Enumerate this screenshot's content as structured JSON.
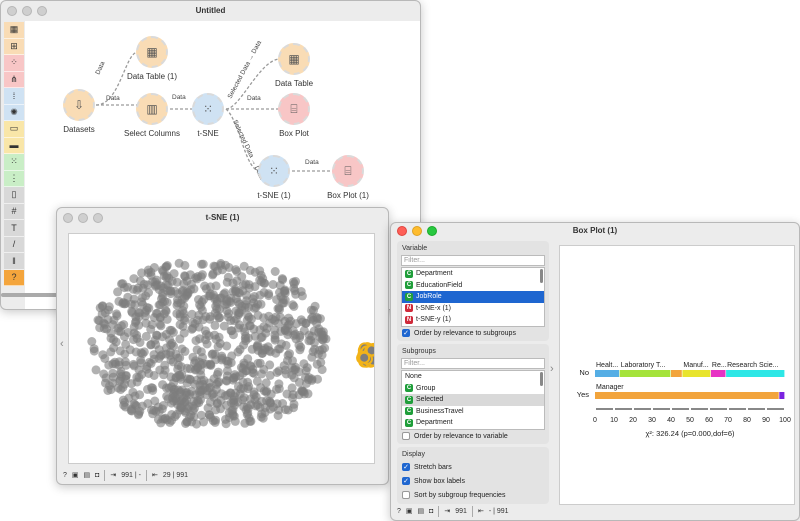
{
  "canvas_window": {
    "title": "Untitled",
    "nodes": [
      {
        "id": "datasets",
        "label": "Datasets",
        "color": "#f9dcb5",
        "icon": "dataset-icon"
      },
      {
        "id": "data_table_1",
        "label": "Data Table (1)",
        "color": "#f9dcb5",
        "icon": "table-icon"
      },
      {
        "id": "select_columns",
        "label": "Select Columns",
        "color": "#f9dcb5",
        "icon": "columns-icon"
      },
      {
        "id": "tsne",
        "label": "t-SNE",
        "color": "#cfe2f3",
        "icon": "tsne-icon"
      },
      {
        "id": "data_table",
        "label": "Data Table",
        "color": "#f9dcb5",
        "icon": "table-icon"
      },
      {
        "id": "box_plot",
        "label": "Box Plot",
        "color": "#f8c6c6",
        "icon": "boxplot-icon"
      },
      {
        "id": "tsne_1",
        "label": "t-SNE (1)",
        "color": "#cfe2f3",
        "icon": "tsne-icon"
      },
      {
        "id": "box_plot_1",
        "label": "Box Plot (1)",
        "color": "#f8c6c6",
        "icon": "boxplot-icon"
      }
    ],
    "edges": [
      {
        "label": "Data"
      },
      {
        "label": "Data"
      },
      {
        "label": "Data"
      },
      {
        "label": "Selected Data → Data"
      },
      {
        "label": "Data"
      },
      {
        "label": "Selected Data → Data"
      },
      {
        "label": "Data"
      }
    ],
    "toolbox": [
      {
        "icon": "table-icon",
        "color": "#f9dcb5"
      },
      {
        "icon": "transform-icon",
        "color": "#f9dcb5"
      },
      {
        "icon": "scatter-icon",
        "color": "#f8c6c6"
      },
      {
        "icon": "hierarchy-icon",
        "color": "#f8c6c6"
      },
      {
        "icon": "distance-icon",
        "color": "#cfe2f3"
      },
      {
        "icon": "cluster-icon",
        "color": "#cfe2f3"
      },
      {
        "icon": "image-icon",
        "color": "#f9e6a8"
      },
      {
        "icon": "image-embed-icon",
        "color": "#f9e6a8"
      },
      {
        "icon": "dots-icon",
        "color": "#c9eec6"
      },
      {
        "icon": "network-icon",
        "color": "#c9eec6"
      },
      {
        "icon": "document-icon",
        "color": "#d8d8d8"
      },
      {
        "icon": "hash-icon",
        "color": "#d8d8d8"
      },
      {
        "icon": "text-icon",
        "color": "#d8d8d8"
      },
      {
        "icon": "pen-icon",
        "color": "#d8d8d8"
      },
      {
        "icon": "pause-icon",
        "color": "#d8d8d8"
      },
      {
        "icon": "help-icon",
        "color": "#f4a53c"
      }
    ]
  },
  "tsne_window": {
    "title": "t-SNE (1)",
    "status": {
      "input": "991 | -",
      "output": "29 | 991"
    },
    "point_color": "#7d7d7d",
    "selected_color": "#f2b318"
  },
  "boxplot_window": {
    "title": "Box Plot (1)",
    "variable": {
      "title": "Variable",
      "filter_placeholder": "Filter...",
      "items": [
        {
          "label": "Department",
          "type": "C",
          "selected": false
        },
        {
          "label": "EducationField",
          "type": "C",
          "selected": false
        },
        {
          "label": "JobRole",
          "type": "C",
          "selected": true
        },
        {
          "label": "t-SNE-x (1)",
          "type": "N",
          "selected": false
        },
        {
          "label": "t-SNE-y (1)",
          "type": "N",
          "selected": false
        }
      ],
      "order_label": "Order by relevance to subgroups",
      "order_checked": true
    },
    "subgroups": {
      "title": "Subgroups",
      "filter_placeholder": "Filter...",
      "items": [
        {
          "label": "None",
          "type": "",
          "highlight": false
        },
        {
          "label": "Group",
          "type": "C",
          "highlight": false
        },
        {
          "label": "Selected",
          "type": "C",
          "highlight": true
        },
        {
          "label": "BusinessTravel",
          "type": "C",
          "highlight": false
        },
        {
          "label": "Department",
          "type": "C",
          "highlight": false
        }
      ],
      "order_label": "Order by relevance to variable",
      "order_checked": false
    },
    "display": {
      "title": "Display",
      "options": [
        {
          "label": "Stretch bars",
          "checked": true
        },
        {
          "label": "Show box labels",
          "checked": true
        },
        {
          "label": "Sort by subgroup frequencies",
          "checked": false
        }
      ]
    },
    "status": {
      "input": "991",
      "output": "- | 991"
    }
  },
  "chart_data": [
    {
      "type": "scatter",
      "title": "",
      "note": "t-SNE projection; gray points unselected, selected subset highlighted with orange outline at far right",
      "series": [
        {
          "name": "",
          "color": "#7d7d7d"
        },
        {
          "name": "",
          "color": "#f2b318"
        }
      ]
    },
    {
      "type": "bar",
      "stacked": true,
      "title": "",
      "categories": [
        "No",
        "Yes"
      ],
      "xlim": [
        0,
        100
      ],
      "xticks": [
        0,
        10,
        20,
        30,
        40,
        50,
        60,
        70,
        80,
        90,
        100
      ],
      "stat_label": "χ²: 326.24 (p=0.000,dof=6)",
      "series": [
        {
          "category": "No",
          "segments": [
            {
              "label": "Healt...",
              "value": 13,
              "color": "#55aee5"
            },
            {
              "label": "Laboratory T...",
              "value": 27,
              "color": "#a5e33b"
            },
            {
              "label": "",
              "value": 6,
              "color": "#f2a43c"
            },
            {
              "label": "Manuf...",
              "value": 15,
              "color": "#e8e42d"
            },
            {
              "label": "Re...",
              "value": 8,
              "color": "#e733c4"
            },
            {
              "label": "Research Scie...",
              "value": 31,
              "color": "#2de7e6"
            }
          ]
        },
        {
          "category": "Yes",
          "segments": [
            {
              "label": "Manager",
              "value": 97,
              "color": "#f2a43c"
            },
            {
              "label": "",
              "value": 3,
              "color": "#7a22e0"
            }
          ]
        }
      ]
    }
  ]
}
